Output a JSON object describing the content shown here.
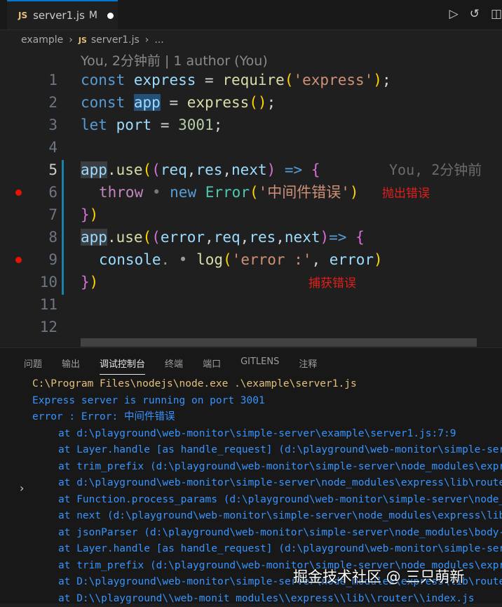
{
  "tab": {
    "js_badge": "JS",
    "filename": "server1.js",
    "modified": "M"
  },
  "toolbar": {
    "run_icon": "▷",
    "history_icon": "↺",
    "split_icon": "◫"
  },
  "breadcrumb": {
    "folder": "example",
    "js_badge": "JS",
    "file": "server1.js",
    "more": "..."
  },
  "blame_header": "You, 2分钟前 | 1 author (You)",
  "lines": {
    "l1": "1",
    "l2": "2",
    "l3": "3",
    "l4": "4",
    "l5": "5",
    "l6": "6",
    "l7": "7",
    "l8": "8",
    "l9": "9",
    "l10": "10",
    "l11": "11",
    "l12": "12"
  },
  "code": {
    "c1": {
      "kw": "const",
      "var": "express",
      "eq": " = ",
      "fn": "require",
      "open": "(",
      "str": "'express'",
      "close": ");"
    },
    "c2": {
      "kw": "const",
      "var": "app",
      "eq": " = ",
      "fn": "express",
      "call": "();"
    },
    "c3": {
      "kw": "let",
      "var": "port",
      "eq": " = ",
      "num": "3001",
      "semi": ";"
    },
    "c5": {
      "obj": "app",
      "dot": ".",
      "fn": "use",
      "o1": "(",
      "o2": "(",
      "a1": "req",
      "c1": ",",
      "a2": "res",
      "c2": ",",
      "a3": "next",
      "c3": ")",
      "arrow": " => ",
      "brace": "{"
    },
    "c6": {
      "kw": "throw",
      "sep": " • ",
      "new": "new",
      "cls": "Error",
      "o": "(",
      "str": "'中间件错误'",
      "c": ")"
    },
    "c7": {
      "c1": "}",
      "c2": ")"
    },
    "c8": {
      "obj": "app",
      "dot": ".",
      "fn": "use",
      "o1": "(",
      "o2": "(",
      "a1": "error",
      "c1": ",",
      "a2": "req",
      "c2": ",",
      "a3": "res",
      "c3": ",",
      "a4": "next",
      "c4": ")",
      "arrow": "=> ",
      "brace": "{"
    },
    "c9": {
      "obj": "console",
      "sep": ". • ",
      "fn": "log",
      "o": "(",
      "str": "'error :'",
      "comma": ", ",
      "arg": "error",
      "c": ")"
    },
    "c10": {
      "c1": "}",
      "c2": ")"
    }
  },
  "inline_blame": "You, 2分钟前",
  "annotations": {
    "throw_note": "抛出错误",
    "catch_note": "捕获错误"
  },
  "panel_tabs": [
    "问题",
    "输出",
    "调试控制台",
    "终端",
    "端口",
    "GITLENS",
    "注释"
  ],
  "console": {
    "cmd": "C:\\Program Files\\nodejs\\node.exe .\\example\\server1.js",
    "running": "Express server is running on port 3001",
    "error": "error : Error: 中间件错误",
    "stack": [
      "at d:\\playground\\web-monitor\\simple-server\\example\\server1.js:7:9",
      "at Layer.handle [as handle_request] (d:\\playground\\web-monitor\\simple-server",
      "at trim_prefix (d:\\playground\\web-monitor\\simple-server\\node_modules\\express",
      "at d:\\playground\\web-monitor\\simple-server\\node_modules\\express\\lib\\router",
      "at Function.process_params (d:\\playground\\web-monitor\\simple-server\\node_mod",
      "at next (d:\\playground\\web-monitor\\simple-server\\node_modules\\express\\lib\\r",
      "at jsonParser (d:\\playground\\web-monitor\\simple-server\\node_modules\\body-par",
      "at Layer.handle [as handle_request] (d:\\playground\\web-monitor\\simple-server",
      "at trim_prefix (d:\\playground\\web-monitor\\simple-server\\node_modules\\express",
      "at D:\\playground\\web-monitor\\simple-server\\node_modules\\express\\lib\\router",
      "at D:\\\\playground\\\\web-monit modules\\\\express\\\\lib\\\\router\\\\index.js"
    ]
  },
  "watermark": "掘金技术社区 @ 三只萌新"
}
